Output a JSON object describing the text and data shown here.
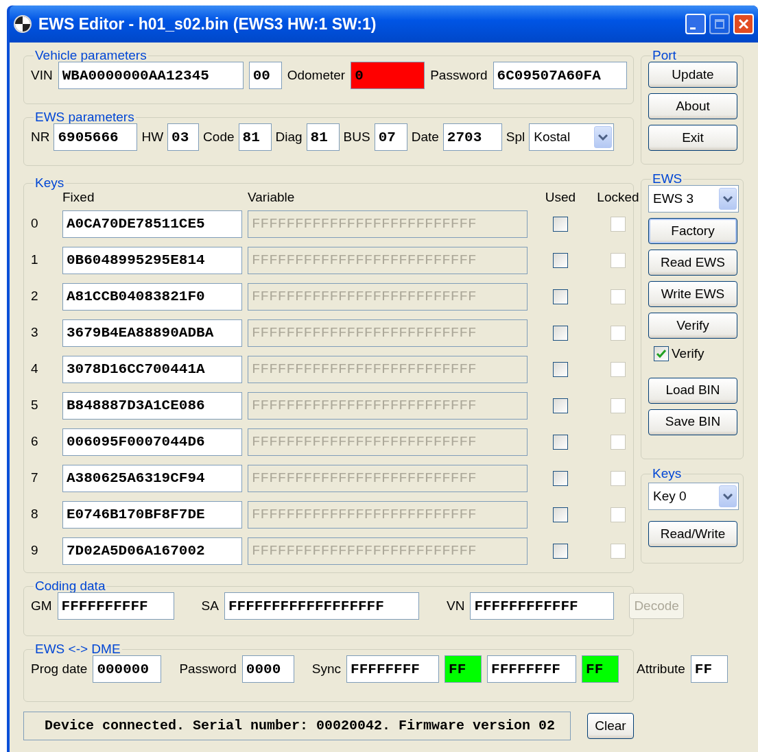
{
  "window": {
    "title": "EWS Editor - h01_s02.bin (EWS3 HW:1 SW:1)"
  },
  "vehicle_parameters": {
    "title": "Vehicle parameters",
    "fields": [
      {
        "label": "VIN",
        "value": "WBA0000000AA12345"
      },
      {
        "value": "00"
      },
      {
        "label": "Odometer",
        "value": "0",
        "color": "#ff0000"
      },
      {
        "label": "Password",
        "value": "6C09507A60FA"
      }
    ]
  },
  "ews_parameters": {
    "title": "EWS parameters",
    "fields": [
      {
        "kind": "input",
        "label": "NR",
        "value": "6905666"
      },
      {
        "kind": "input",
        "label": "HW",
        "value": "03"
      },
      {
        "kind": "input",
        "label": "Code",
        "value": "81"
      },
      {
        "kind": "input",
        "label": "Diag",
        "value": "81"
      },
      {
        "kind": "input",
        "label": "BUS",
        "value": "07"
      },
      {
        "kind": "input",
        "label": "Date",
        "value": "2703"
      },
      {
        "kind": "select",
        "label": "Spl",
        "value": "Kostal"
      }
    ]
  },
  "keys": {
    "title": "Keys",
    "columns": [
      "Fixed",
      "Variable",
      "Used",
      "Locked"
    ],
    "rows": [
      {
        "index": "0",
        "fixed": "A0CA70DE78511CE5",
        "variable": "FFFFFFFFFFFFFFFFFFFFFFFFFF",
        "variable_disabled": true,
        "used": false,
        "locked": false,
        "locked_disabled": true
      },
      {
        "index": "1",
        "fixed": "0B6048995295E814",
        "variable": "FFFFFFFFFFFFFFFFFFFFFFFFFF",
        "variable_disabled": true,
        "used": false,
        "locked": false,
        "locked_disabled": true
      },
      {
        "index": "2",
        "fixed": "A81CCB04083821F0",
        "variable": "FFFFFFFFFFFFFFFFFFFFFFFFFF",
        "variable_disabled": true,
        "used": false,
        "locked": false,
        "locked_disabled": true
      },
      {
        "index": "3",
        "fixed": "3679B4EA88890ADBA",
        "variable": "FFFFFFFFFFFFFFFFFFFFFFFFFF",
        "variable_disabled": true,
        "used": false,
        "locked": false,
        "locked_disabled": true
      },
      {
        "index": "4",
        "fixed": "3078D16CC700441A",
        "variable": "FFFFFFFFFFFFFFFFFFFFFFFFFF",
        "variable_disabled": true,
        "used": false,
        "locked": false,
        "locked_disabled": true
      },
      {
        "index": "5",
        "fixed": "B848887D3A1CE086",
        "variable": "FFFFFFFFFFFFFFFFFFFFFFFFFF",
        "variable_disabled": true,
        "used": false,
        "locked": false,
        "locked_disabled": true
      },
      {
        "index": "6",
        "fixed": "006095F0007044D6",
        "variable": "FFFFFFFFFFFFFFFFFFFFFFFFFF",
        "variable_disabled": true,
        "used": false,
        "locked": false,
        "locked_disabled": true
      },
      {
        "index": "7",
        "fixed": "A380625A6319CF94",
        "variable": "FFFFFFFFFFFFFFFFFFFFFFFFFF",
        "variable_disabled": true,
        "used": false,
        "locked": false,
        "locked_disabled": true
      },
      {
        "index": "8",
        "fixed": "E0746B170BF8F7DE",
        "variable": "FFFFFFFFFFFFFFFFFFFFFFFFFF",
        "variable_disabled": true,
        "used": false,
        "locked": false,
        "locked_disabled": true
      },
      {
        "index": "9",
        "fixed": "7D02A5D06A167002",
        "variable": "FFFFFFFFFFFFFFFFFFFFFFFFFF",
        "variable_disabled": true,
        "used": false,
        "locked": false,
        "locked_disabled": true
      }
    ]
  },
  "coding_data": {
    "title": "Coding data",
    "fields": [
      {
        "label": "GM",
        "value": "FFFFFFFFFF"
      },
      {
        "label": "SA",
        "value": "FFFFFFFFFFFFFFFFFF"
      },
      {
        "label": "VN",
        "value": "FFFFFFFFFFFF"
      }
    ],
    "button": {
      "label": "Decode",
      "disabled": true
    }
  },
  "ews_dme": {
    "title": "EWS <-> DME",
    "fields": [
      {
        "label": "Prog date",
        "value": "000000"
      },
      {
        "label": "Password",
        "value": "0000"
      },
      {
        "label": "Sync",
        "value": "FFFFFFFF"
      },
      {
        "value": "FF",
        "color": "#00ff00"
      },
      {
        "value": "FFFFFFFF"
      },
      {
        "value": "FF",
        "color": "#00ff00"
      },
      {
        "label": "Attribute",
        "value": "FF"
      }
    ]
  },
  "status_bar": {
    "text": "Device connected. Serial number: 00020042. Firmware version 02",
    "button": "Clear"
  },
  "port": {
    "title": "Port",
    "buttons": [
      {
        "label": "Update",
        "focused": false
      },
      {
        "label": "About",
        "focused": false
      },
      {
        "label": "Exit",
        "focused": false
      }
    ]
  },
  "ews": {
    "title": "EWS",
    "select": "EWS 3",
    "items": [
      {
        "kind": "button",
        "label": "Factory",
        "focused": true
      },
      {
        "kind": "button",
        "label": "Read EWS",
        "focused": false
      },
      {
        "kind": "button",
        "label": "Write EWS",
        "focused": false
      },
      {
        "kind": "button",
        "label": "Verify",
        "focused": false
      },
      {
        "kind": "checkbox",
        "label": "Verify",
        "checked": true
      },
      {
        "kind": "button",
        "label": "Load BIN",
        "focused": false
      },
      {
        "kind": "button",
        "label": "Save BIN",
        "focused": false
      }
    ]
  },
  "keys_panel": {
    "title": "Keys",
    "select": "Key 0",
    "button": "Read/Write"
  }
}
